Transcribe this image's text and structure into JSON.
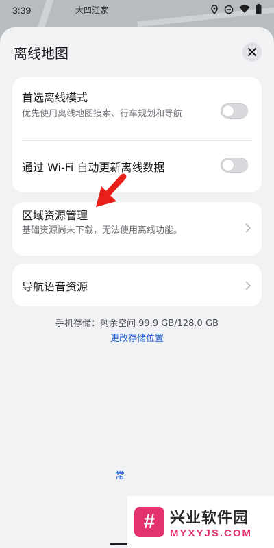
{
  "status_bar": {
    "time": "3:39",
    "map_label": "大凹汪家",
    "icons": [
      "location-icon",
      "dnd-icon",
      "wifi-icon",
      "battery-icon"
    ]
  },
  "sheet": {
    "title": "离线地图",
    "close_icon": "close-icon"
  },
  "settings": {
    "preferred_offline": {
      "title": "首选离线模式",
      "subtitle": "优先使用离线地图搜索、行车规划和导航",
      "enabled": false
    },
    "wifi_auto_update": {
      "title": "通过 Wi-Fi 自动更新离线数据",
      "enabled": false
    }
  },
  "region_resources": {
    "title": "区域资源管理",
    "subtitle": "基础资源尚未下载，无法使用离线功能。"
  },
  "nav_voice": {
    "title": "导航语音资源"
  },
  "storage": {
    "info": "手机存储：剩余空间 99.9 GB/128.0 GB",
    "change_link": "更改存储位置"
  },
  "bottom_tab_partial": "常",
  "watermark": {
    "logo_glyph": "#",
    "cn": "兴业软件园",
    "en": "MYXYJS.COM"
  },
  "colors": {
    "accent": "#1c5ed6",
    "annotation_arrow": "#e8201a",
    "watermark_pink": "#e4326c"
  }
}
